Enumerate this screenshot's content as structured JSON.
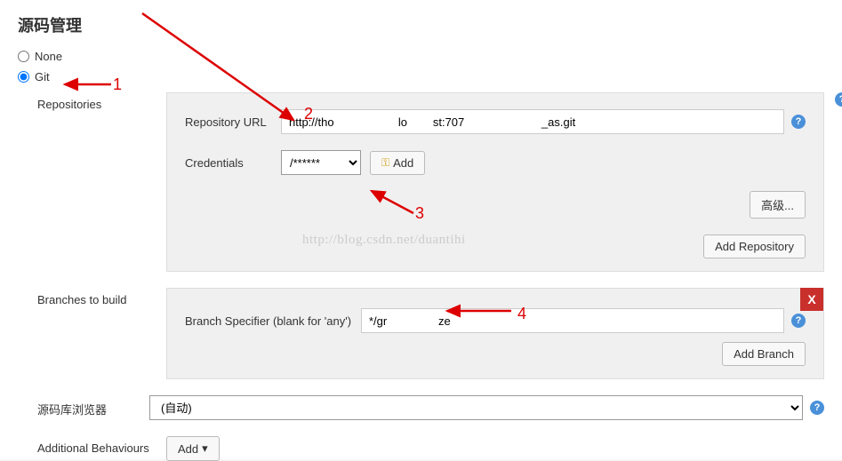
{
  "section_title": "源码管理",
  "scm": {
    "none_label": "None",
    "git_label": "Git",
    "selected": "git"
  },
  "repositories": {
    "label": "Repositories",
    "url_label": "Repository URL",
    "url_value": "http://tho                    lo        st:707                        _as.git",
    "credentials_label": "Credentials",
    "credentials_value": "    /******",
    "add_credentials": "Add",
    "advanced": "高级...",
    "add_repo": "Add Repository"
  },
  "branches": {
    "label": "Branches to build",
    "specifier_label": "Branch Specifier (blank for 'any')",
    "specifier_value": "*/gr                ze",
    "add_branch": "Add Branch",
    "close": "X"
  },
  "repo_browser": {
    "label": "源码库浏览器",
    "value": "(自动)"
  },
  "additional": {
    "label": "Additional Behaviours",
    "add": "Add"
  },
  "watermark": "http://blog.csdn.net/duantihi",
  "annotations": {
    "n1": "1",
    "n2": "2",
    "n3": "3",
    "n4": "4"
  }
}
